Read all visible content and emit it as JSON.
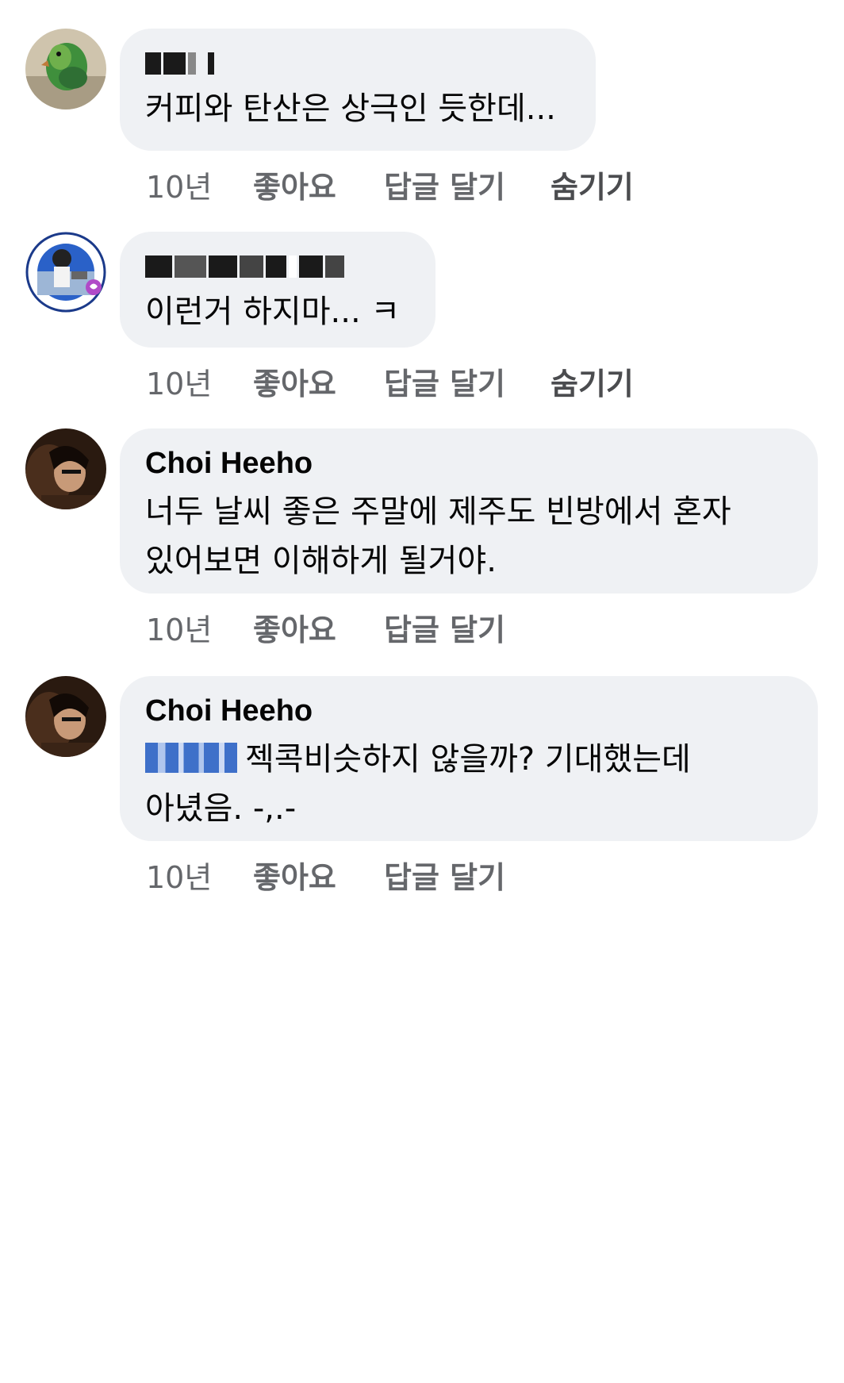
{
  "comments": [
    {
      "author": "",
      "author_obscured": true,
      "text": "커피와 탄산은 상극인 듯한데...",
      "time": "10년",
      "like_label": "좋아요",
      "reply_label": "답글 달기",
      "hide_label": "숨기기"
    },
    {
      "author": "",
      "author_obscured": true,
      "text": "이런거 하지마... ㅋ",
      "time": "10년",
      "like_label": "좋아요",
      "reply_label": "답글 달기",
      "hide_label": "숨기기"
    },
    {
      "author": "Choi Heeho",
      "text_line1": "너두 날씨 좋은 주말에 제주도 빈방에서 혼자",
      "text_line2": "있어보면 이해하게 될거야.",
      "time": "10년",
      "like_label": "좋아요",
      "reply_label": "답글 달기"
    },
    {
      "author": "Choi Heeho",
      "mention_obscured": true,
      "text_line1": "젝콕비슷하지 않을까? 기대했는데",
      "text_line2": "아녔음. -,.-",
      "time": "10년",
      "like_label": "좋아요",
      "reply_label": "답글 달기"
    }
  ],
  "colors": {
    "bubble": "#eff1f4",
    "meta_text": "#65676b",
    "mention": "#2b62c4"
  }
}
